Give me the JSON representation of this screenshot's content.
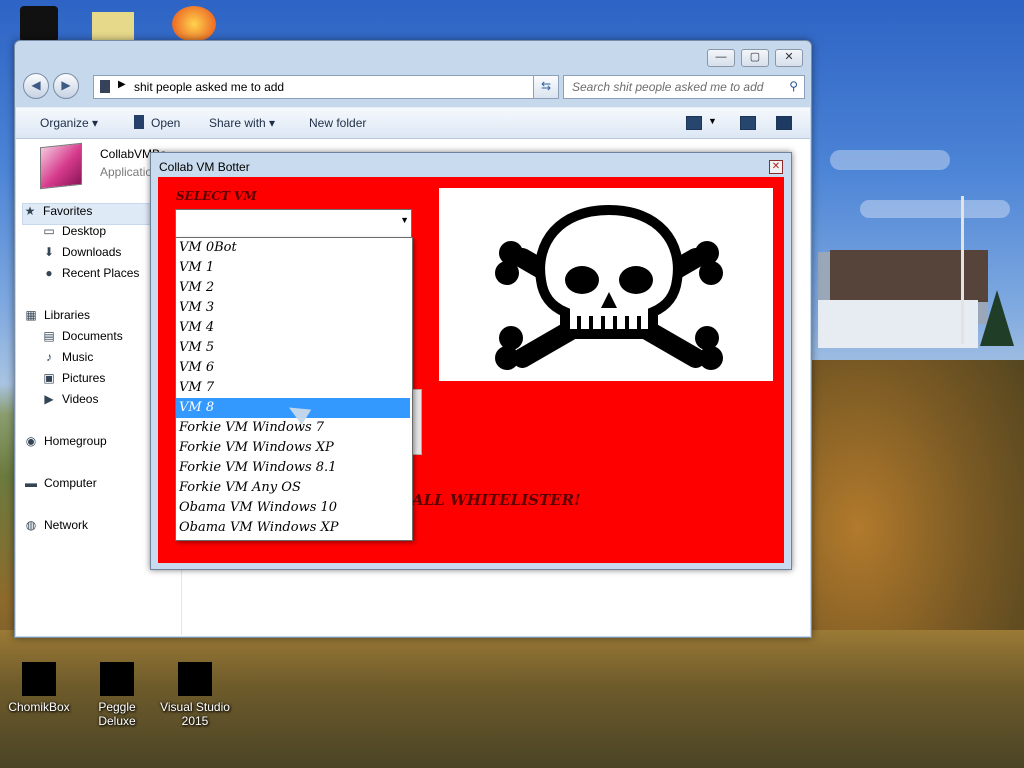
{
  "desktop": {
    "icons": [
      {
        "label": "ChomikBox"
      },
      {
        "label": "Peggle Deluxe"
      },
      {
        "label": "Visual Studio 2015"
      }
    ]
  },
  "explorer": {
    "address": "shit people asked me to add",
    "search_placeholder": "Search shit people asked me to add",
    "toolbar": {
      "organize": "Organize ▾",
      "open": "Open",
      "share_with": "Share with ▾",
      "new_folder": "New folder"
    },
    "file": {
      "name": "CollabVMBo",
      "type": "Applicatio"
    },
    "nav": {
      "favorites": "Favorites",
      "desktop": "Desktop",
      "downloads": "Downloads",
      "recent_places": "Recent Places",
      "libraries": "Libraries",
      "documents": "Documents",
      "music": "Music",
      "pictures": "Pictures",
      "videos": "Videos",
      "homegroup": "Homegroup",
      "computer": "Computer",
      "network": "Network"
    }
  },
  "botter": {
    "title": "Collab VM Botter",
    "select_label": "SELECT VM",
    "combo_value": "",
    "whitelister_text": "ALL WHITELISTER!",
    "options": [
      "VM 0Bot",
      "VM 1",
      "VM 2",
      "VM 3",
      "VM 4",
      "VM 5",
      "VM 6",
      "VM 7",
      "VM 8",
      "Forkie VM Windows 7",
      "Forkie VM Windows XP",
      "Forkie VM Windows 8.1",
      "Forkie VM Any OS",
      "Obama VM Windows 10",
      "Obama VM Windows XP"
    ],
    "selected_option": "VM 8"
  },
  "colors": {
    "panel_red": "#ff0000",
    "selection_blue": "#3399ff"
  }
}
